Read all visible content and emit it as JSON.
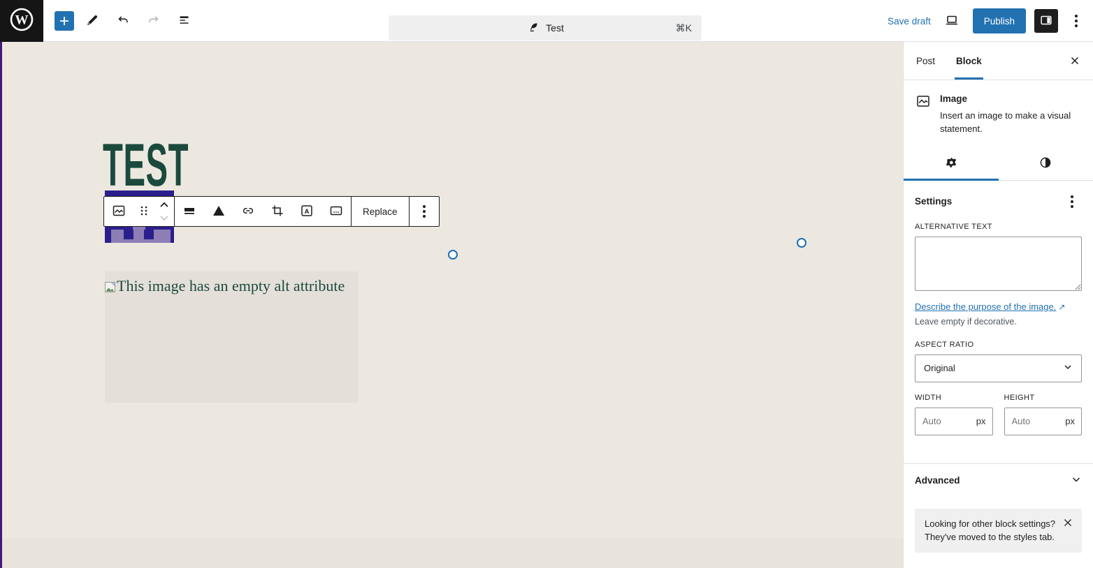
{
  "topbar": {
    "inserter_tooltip": "add-block",
    "command": {
      "title": "Test",
      "shortcut": "⌘K"
    },
    "save_draft_label": "Save draft",
    "publish_label": "Publish"
  },
  "canvas": {
    "post_heading": "TEST",
    "broken_image_alt_text": "This image has an empty alt attribute"
  },
  "block_toolbar": {
    "replace_label": "Replace"
  },
  "sidebar": {
    "tabs": {
      "post": "Post",
      "block": "Block"
    },
    "block_card": {
      "title": "Image",
      "description": "Insert an image to make a visual statement."
    },
    "settings": {
      "heading": "Settings",
      "alt_label": "ALTERNATIVE TEXT",
      "alt_value": "",
      "describe_link": "Describe the purpose of the image.",
      "external_arrow": "↗",
      "decorative_note": "Leave empty if decorative.",
      "aspect_label": "ASPECT RATIO",
      "aspect_value": "Original",
      "width_label": "WIDTH",
      "height_label": "HEIGHT",
      "dimension_placeholder": "Auto",
      "unit": "px",
      "advanced_label": "Advanced",
      "notice_text": "Looking for other block settings? They've moved to the styles tab."
    }
  },
  "colors": {
    "admin_blue": "#2271b1",
    "topbar_black": "#151515",
    "canvas_beige": "#ece8e0",
    "canvas_band": "#e8e4db",
    "heading_green": "#1b4a3d",
    "edge_purple": "#45187d",
    "image_navy": "#2b1f8e",
    "image_lilac": "#8d7eb5",
    "notice_gray": "#f0f0f0"
  }
}
